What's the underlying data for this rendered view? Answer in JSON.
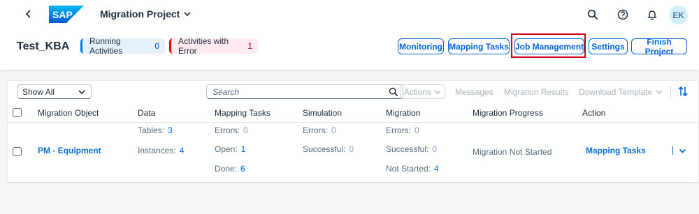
{
  "shell": {
    "logo_text": "SAP",
    "app_title": "Migration Project",
    "avatar_initials": "EK",
    "icons": [
      "back-icon",
      "chevron-down-icon",
      "search-icon",
      "help-icon",
      "bell-icon"
    ]
  },
  "header": {
    "object_title": "Test_KBA",
    "running_label": "Running Activities",
    "running_count": "0",
    "error_label": "Activities with Error",
    "error_count": "1",
    "buttons": {
      "monitoring": "Monitoring",
      "mapping_tasks": "Mapping Tasks",
      "job_management": "Job Management",
      "settings": "Settings",
      "finish_project": "Finish Project"
    },
    "highlighted_button": "job_management"
  },
  "toolbar": {
    "filter_value": "Show All",
    "search_placeholder": "Search",
    "actions_label": "Actions",
    "messages_label": "Messages",
    "migration_results_label": "Migration Results",
    "download_template_label": "Download Template"
  },
  "table": {
    "columns": [
      "Migration Object",
      "Data",
      "Mapping Tasks",
      "Simulation",
      "Migration",
      "Migration Progress",
      "Action"
    ],
    "rows": [
      {
        "migration_object": "PM - Equipment",
        "data": {
          "tables_label": "Tables:",
          "tables": "3",
          "instances_label": "Instances:",
          "instances": "4"
        },
        "mapping_tasks": {
          "errors_label": "Errors:",
          "errors": "0",
          "open_label": "Open:",
          "open": "1",
          "done_label": "Done:",
          "done": "6"
        },
        "simulation": {
          "errors_label": "Errors:",
          "errors": "0",
          "successful_label": "Successful:",
          "successful": "0"
        },
        "migration": {
          "errors_label": "Errors:",
          "errors": "0",
          "successful_label": "Successful:",
          "successful": "0",
          "not_started_label": "Not Started:",
          "not_started": "4"
        },
        "progress": "Migration Not Started",
        "action": "Mapping Tasks"
      }
    ]
  },
  "colors": {
    "accent": "#0064d9",
    "highlight_box": "#d0021b",
    "error": "#e00000"
  }
}
